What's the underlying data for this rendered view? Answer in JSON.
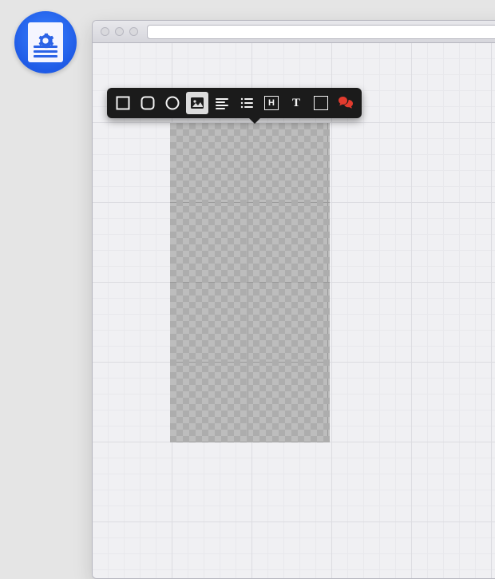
{
  "app_badge": {
    "name": "page-builder-app"
  },
  "window": {
    "url_value": "",
    "url_placeholder": ""
  },
  "toolbar": {
    "items": [
      {
        "id": "square",
        "label": "Square shape",
        "selected": false
      },
      {
        "id": "rounded",
        "label": "Rounded shape",
        "selected": false
      },
      {
        "id": "circle",
        "label": "Circle shape",
        "selected": false
      },
      {
        "id": "image",
        "label": "Image",
        "selected": true
      },
      {
        "id": "align-left",
        "label": "Text lines (left)",
        "selected": false
      },
      {
        "id": "list",
        "label": "List / content",
        "selected": false
      },
      {
        "id": "heading",
        "label": "Heading",
        "selected": false,
        "glyph": "H"
      },
      {
        "id": "text",
        "label": "Text",
        "selected": false,
        "glyph": "T"
      },
      {
        "id": "spacer",
        "label": "Spacer / box",
        "selected": false
      },
      {
        "id": "comment",
        "label": "Comment",
        "selected": false
      }
    ]
  },
  "canvas": {
    "placeholder": {
      "type": "image-placeholder"
    }
  }
}
